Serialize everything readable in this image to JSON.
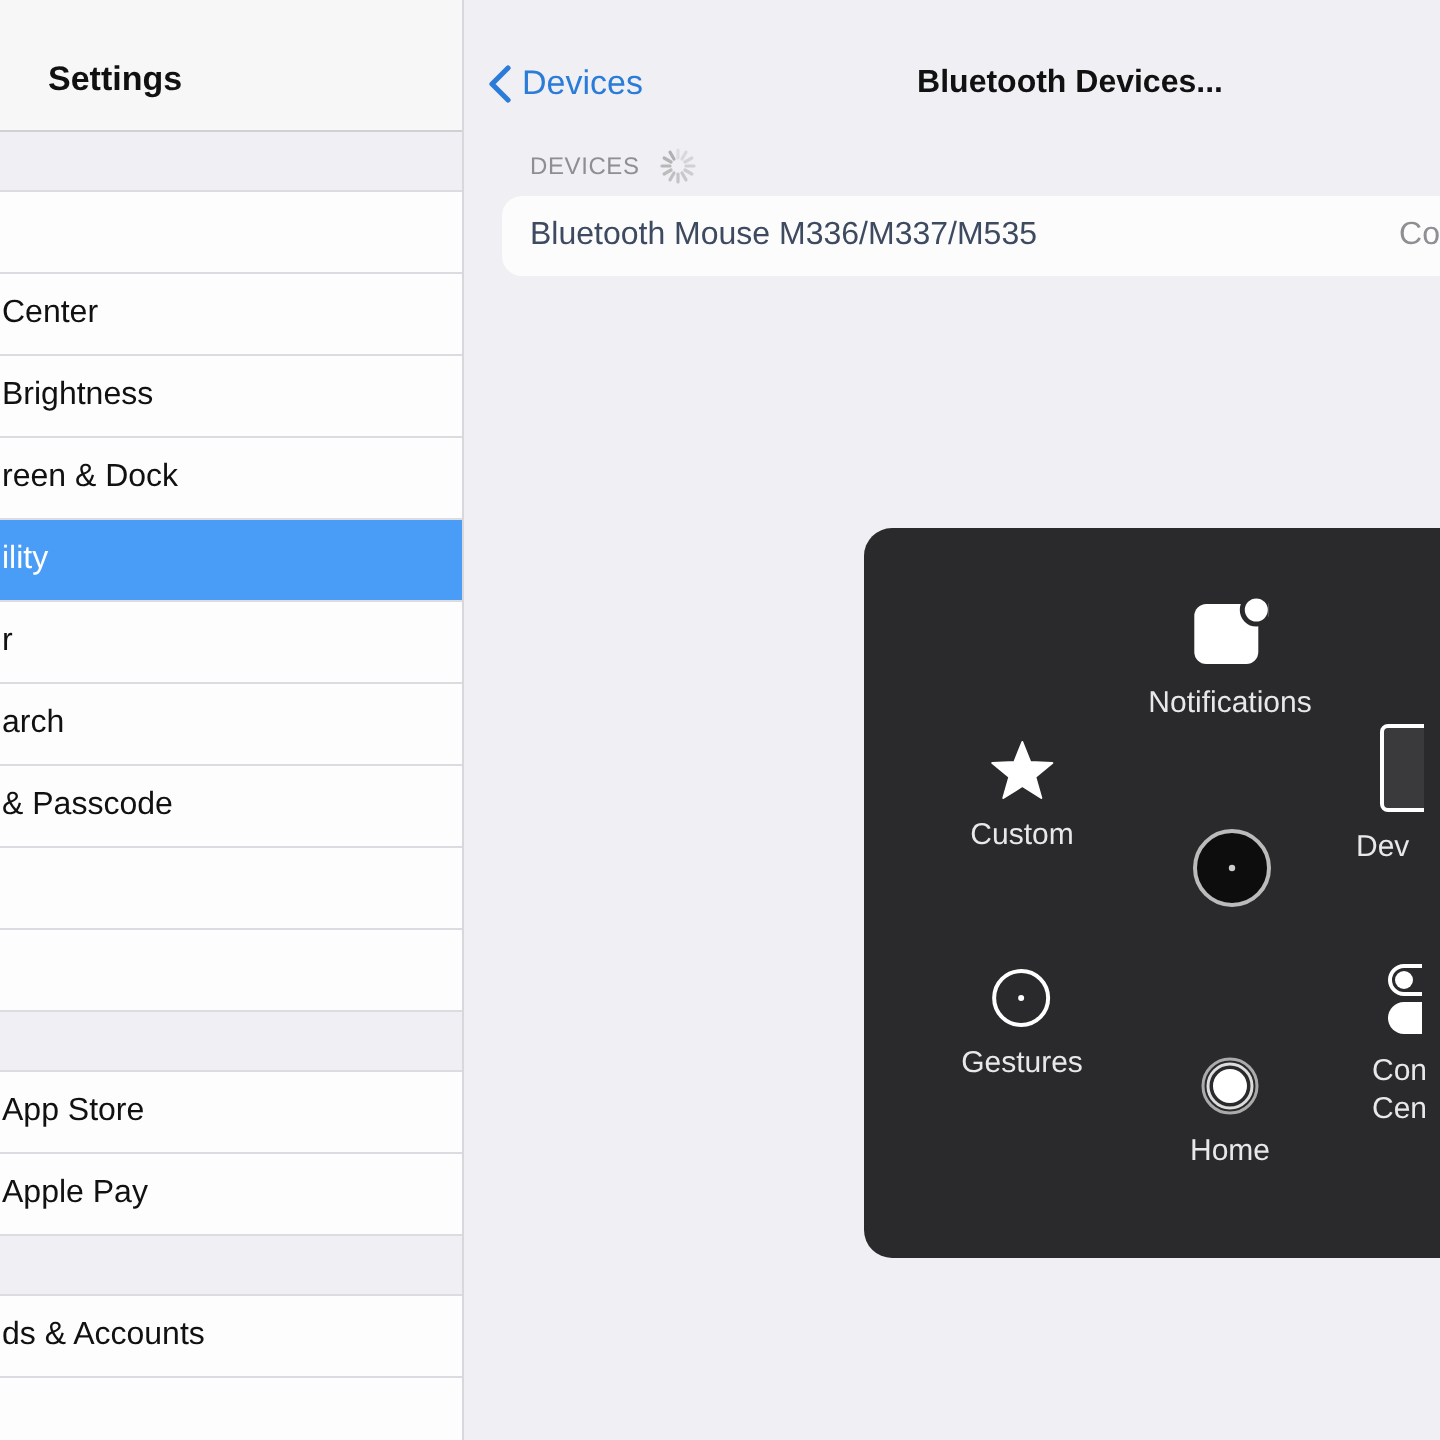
{
  "sidebar": {
    "title": "Settings",
    "groups": [
      {
        "items": [
          {
            "selected": false
          },
          {
            "label": "Center",
            "selected": false
          },
          {
            "label": "Brightness",
            "selected": false
          },
          {
            "label": "reen & Dock",
            "selected": false
          },
          {
            "label": "ility",
            "selected": true
          },
          {
            "label": "r",
            "selected": false
          },
          {
            "label": "arch",
            "selected": false
          },
          {
            "label": "& Passcode",
            "selected": false
          },
          {
            "selected": false
          },
          {
            "selected": false
          }
        ]
      },
      {
        "items": [
          {
            "label": "App Store",
            "selected": false
          },
          {
            "label": "Apple Pay",
            "selected": false
          }
        ]
      },
      {
        "items": [
          {
            "label": "ds & Accounts",
            "selected": false
          },
          {
            "selected": false
          }
        ]
      }
    ]
  },
  "detail": {
    "back": "Devices",
    "title": "Bluetooth Devices...",
    "section": "DEVICES",
    "loading": true,
    "devices": [
      {
        "name": "Bluetooth Mouse M336/M337/M535",
        "status": "Co"
      }
    ]
  },
  "assistive_menu": {
    "items": [
      {
        "kind": "notifications",
        "label": "Notifications"
      },
      {
        "kind": "custom",
        "label": "Custom"
      },
      {
        "kind": "center"
      },
      {
        "kind": "device",
        "label": "Dev"
      },
      {
        "kind": "gestures",
        "label": "Gestures"
      },
      {
        "kind": "home",
        "label": "Home"
      },
      {
        "kind": "control",
        "label": "Con\nCen"
      }
    ]
  }
}
